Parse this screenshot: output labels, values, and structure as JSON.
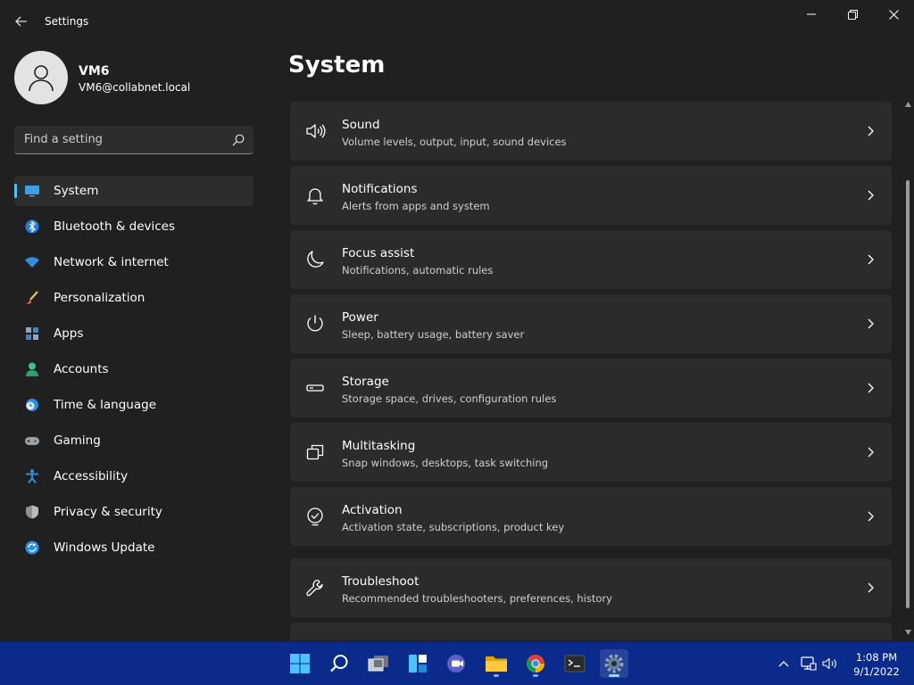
{
  "window": {
    "title": "Settings"
  },
  "user": {
    "name": "VM6",
    "email": "VM6@collabnet.local"
  },
  "search": {
    "placeholder": "Find a setting"
  },
  "nav": [
    {
      "label": "System",
      "icon": "monitor-icon",
      "selected": true
    },
    {
      "label": "Bluetooth & devices",
      "icon": "bluetooth-icon"
    },
    {
      "label": "Network & internet",
      "icon": "wifi-icon"
    },
    {
      "label": "Personalization",
      "icon": "brush-icon"
    },
    {
      "label": "Apps",
      "icon": "apps-icon"
    },
    {
      "label": "Accounts",
      "icon": "person-icon"
    },
    {
      "label": "Time & language",
      "icon": "clock-globe-icon"
    },
    {
      "label": "Gaming",
      "icon": "gamepad-icon"
    },
    {
      "label": "Accessibility",
      "icon": "accessibility-icon"
    },
    {
      "label": "Privacy & security",
      "icon": "shield-icon"
    },
    {
      "label": "Windows Update",
      "icon": "update-icon"
    }
  ],
  "main": {
    "title": "System",
    "items": [
      {
        "title": "Sound",
        "desc": "Volume levels, output, input, sound devices",
        "icon": "speaker-icon"
      },
      {
        "title": "Notifications",
        "desc": "Alerts from apps and system",
        "icon": "bell-icon"
      },
      {
        "title": "Focus assist",
        "desc": "Notifications, automatic rules",
        "icon": "moon-icon"
      },
      {
        "title": "Power",
        "desc": "Sleep, battery usage, battery saver",
        "icon": "power-icon"
      },
      {
        "title": "Storage",
        "desc": "Storage space, drives, configuration rules",
        "icon": "drive-icon"
      },
      {
        "title": "Multitasking",
        "desc": "Snap windows, desktops, task switching",
        "icon": "multitask-icon"
      },
      {
        "title": "Activation",
        "desc": "Activation state, subscriptions, product key",
        "icon": "check-circle-icon"
      },
      {
        "title": "Troubleshoot",
        "desc": "Recommended troubleshooters, preferences, history",
        "icon": "wrench-icon"
      }
    ]
  },
  "taskbar": {
    "apps": [
      "windows-start-icon",
      "search-icon",
      "task-view-icon",
      "widgets-icon",
      "chat-icon",
      "file-explorer-icon",
      "chrome-icon",
      "terminal-icon",
      "settings-icon"
    ],
    "time": "1:08 PM",
    "date": "9/1/2022"
  },
  "colors": {
    "accent": "#4cc2ff",
    "background": "#202020",
    "card": "#2b2b2b",
    "taskbar": "#0a2a8c"
  }
}
